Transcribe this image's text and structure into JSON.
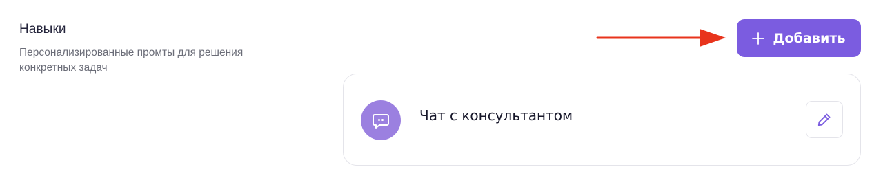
{
  "section": {
    "title": "Навыки",
    "description": "Персонализированные промты для решения конкретных задач"
  },
  "toolbar": {
    "add_label": "Добавить",
    "add_icon": "plus-icon"
  },
  "annotation": {
    "arrow_icon": "red-arrow-icon",
    "arrow_color": "#e8341c"
  },
  "skills": [
    {
      "name": "Чат с консультантом",
      "icon": "chat-bubble-icon",
      "edit_icon": "pencil-icon"
    }
  ],
  "colors": {
    "accent": "#7b5ce0",
    "avatar_bg": "#9b80e0",
    "title_text": "#23233a",
    "muted_text": "#6b6d78",
    "border": "#e4e4ea"
  }
}
